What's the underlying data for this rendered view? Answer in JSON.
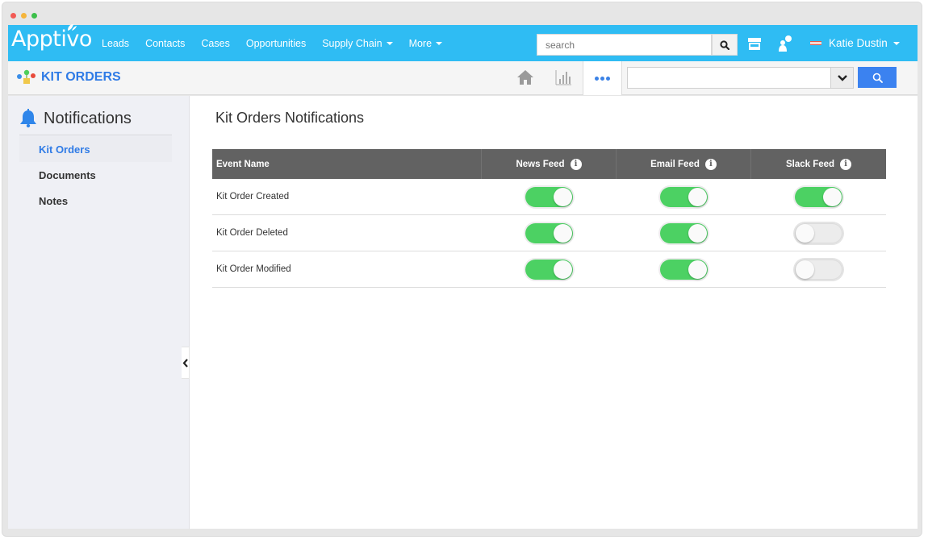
{
  "window": {
    "controls": [
      "close",
      "minimize",
      "maximize"
    ]
  },
  "topbar": {
    "logo": "Apptivo",
    "nav": [
      {
        "label": "Leads",
        "dropdown": false
      },
      {
        "label": "Contacts",
        "dropdown": false
      },
      {
        "label": "Cases",
        "dropdown": false
      },
      {
        "label": "Opportunities",
        "dropdown": false
      },
      {
        "label": "Supply Chain",
        "dropdown": true
      },
      {
        "label": "More",
        "dropdown": true
      }
    ],
    "search": {
      "placeholder": "search",
      "value": ""
    },
    "icons": [
      "search-icon",
      "store-icon",
      "user-switch-icon"
    ],
    "user": {
      "name": "Katie Dustin"
    },
    "color": "#2fbcf3"
  },
  "appbar": {
    "title": "KIT ORDERS",
    "icons": [
      "home-icon",
      "bar-chart-icon",
      "more-dots-icon"
    ],
    "select": {
      "value": ""
    },
    "accent": "#2f7be6"
  },
  "sidebar": {
    "heading": "Notifications",
    "items": [
      {
        "label": "Kit Orders",
        "active": true
      },
      {
        "label": "Documents",
        "active": false
      },
      {
        "label": "Notes",
        "active": false
      }
    ]
  },
  "main": {
    "title": "Kit Orders Notifications",
    "table": {
      "columns": [
        "Event Name",
        "News Feed",
        "Email Feed",
        "Slack Feed"
      ],
      "rows": [
        {
          "event": "Kit Order Created",
          "news": true,
          "email": true,
          "slack": true
        },
        {
          "event": "Kit Order Deleted",
          "news": true,
          "email": true,
          "slack": false
        },
        {
          "event": "Kit Order Modified",
          "news": true,
          "email": true,
          "slack": false
        }
      ]
    },
    "toggle_on_color": "#4cd163"
  }
}
